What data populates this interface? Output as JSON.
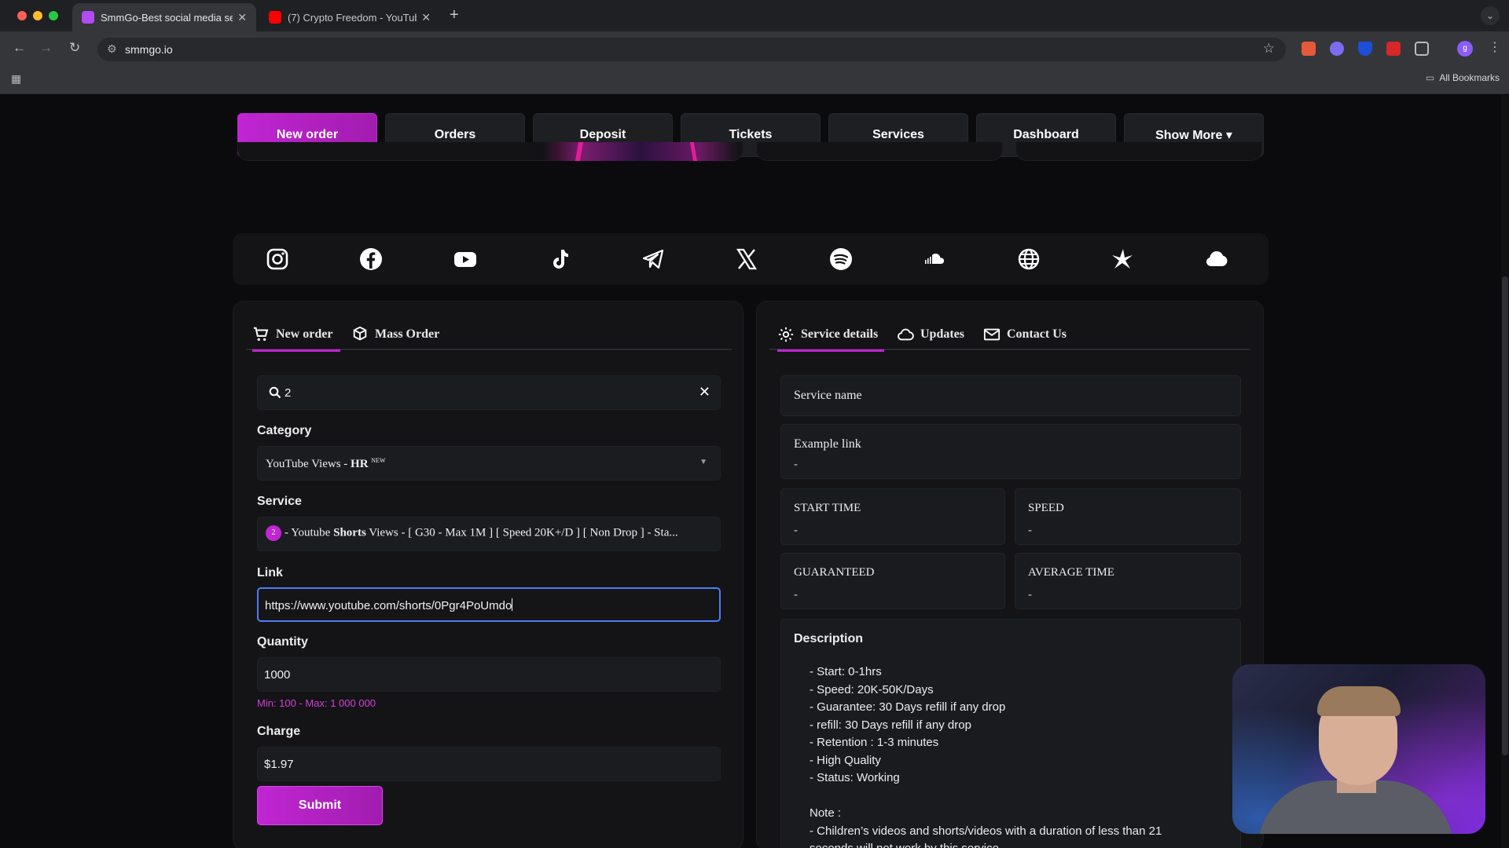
{
  "browser": {
    "tabs": [
      {
        "title": "SmmGo-Best social media se",
        "active": true,
        "favicon_color": "#b14bf4"
      },
      {
        "title": "(7) Crypto Freedom - YouTub",
        "active": false,
        "favicon_color": "#ff0000"
      }
    ],
    "url": "smmgo.io",
    "bookmarks_label": "All Bookmarks",
    "profile_initial": "g"
  },
  "nav": {
    "items": [
      {
        "label": "New order",
        "active": true
      },
      {
        "label": "Orders"
      },
      {
        "label": "Deposit"
      },
      {
        "label": "Tickets"
      },
      {
        "label": "Services"
      },
      {
        "label": "Dashboard"
      },
      {
        "label": "Show More ▾"
      }
    ]
  },
  "social_icons": [
    "instagram-icon",
    "facebook-icon",
    "youtube-icon",
    "tiktok-icon",
    "telegram-icon",
    "x-icon",
    "spotify-icon",
    "soundcloud-icon",
    "globe-icon",
    "star-burst-icon",
    "cloud-icon"
  ],
  "order_form": {
    "tabs": {
      "new_order": "New order",
      "mass_order": "Mass Order"
    },
    "search": {
      "value": "2"
    },
    "category": {
      "label": "Category",
      "value": "YouTube Views - ",
      "value_bold": "HR",
      "sup": "NEW"
    },
    "service": {
      "label": "Service",
      "badge": "2",
      "value_pre": "- Youtube ",
      "value_bold": "Shorts",
      "value_post": " Views - [ G30 - Max 1M ] [ Speed 20K+/D ] [ Non Drop ] - Sta..."
    },
    "link": {
      "label": "Link",
      "value": "https://www.youtube.com/shorts/0Pgr4PoUmdo"
    },
    "quantity": {
      "label": "Quantity",
      "value": "1000",
      "hint": "Min: 100 - Max: 1 000 000"
    },
    "charge": {
      "label": "Charge",
      "value": "$1.97"
    },
    "submit": "Submit"
  },
  "details": {
    "tabs": {
      "service_details": "Service details",
      "updates": "Updates",
      "contact": "Contact Us"
    },
    "service_name": "Service name",
    "example_link": {
      "label": "Example link",
      "value": "-"
    },
    "start_time": {
      "label": "START TIME",
      "value": "-"
    },
    "speed": {
      "label": "SPEED",
      "value": "-"
    },
    "guaranteed": {
      "label": "GUARANTEED",
      "value": "-"
    },
    "average_time": {
      "label": "AVERAGE TIME",
      "value": "-"
    },
    "description": {
      "title": "Description",
      "lines": [
        "- Start: 0-1hrs",
        "- Speed: 20K-50K/Days",
        "- Guarantee: 30 Days refill if any drop",
        "- refill: 30 Days refill if any drop",
        "- Retention : 1-3 minutes",
        "- High Quality",
        "- Status: Working",
        "",
        "Note :",
        "- Children’s videos and shorts/videos with a duration of less than 21",
        "seconds will not work by this service"
      ]
    }
  }
}
